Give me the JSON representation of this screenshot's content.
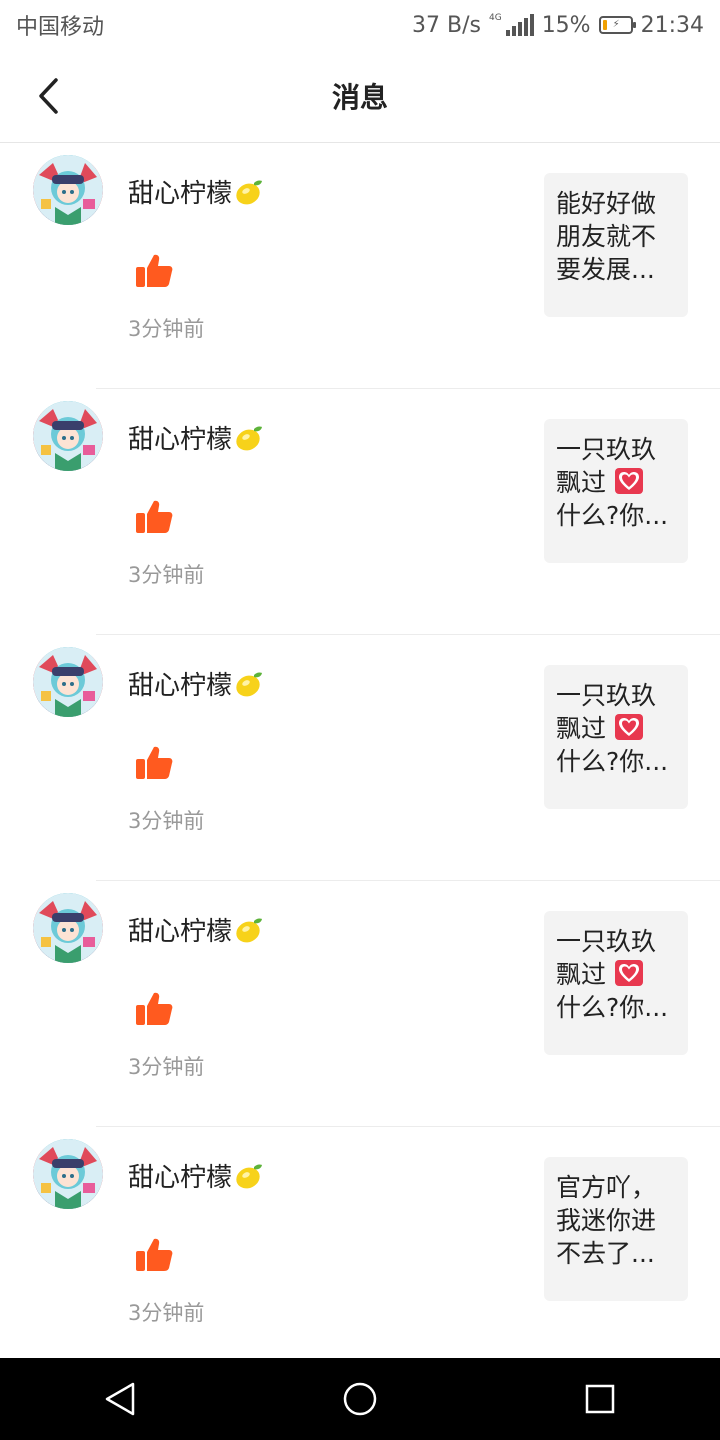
{
  "status_bar": {
    "carrier": "中国移动",
    "net_speed": "37 B/s",
    "network": "4G",
    "battery_percent": "15%",
    "battery_level": 0.15,
    "time": "21:34"
  },
  "header": {
    "title": "消息",
    "back_icon": "chevron-left-icon"
  },
  "notifications": [
    {
      "username": "甜心柠檬",
      "username_emoji": "lemon-icon",
      "action_icon": "thumbs-up-icon",
      "time": "3分钟前",
      "preview": [
        "能好好做",
        "朋友就不",
        "要发展..."
      ]
    },
    {
      "username": "甜心柠檬",
      "username_emoji": "lemon-icon",
      "action_icon": "thumbs-up-icon",
      "time": "3分钟前",
      "preview": [
        "一只玖玖",
        "飘过",
        "什么?你..."
      ]
    },
    {
      "username": "甜心柠檬",
      "username_emoji": "lemon-icon",
      "action_icon": "thumbs-up-icon",
      "time": "3分钟前",
      "preview": [
        "一只玖玖",
        "飘过",
        "什么?你..."
      ]
    },
    {
      "username": "甜心柠檬",
      "username_emoji": "lemon-icon",
      "action_icon": "thumbs-up-icon",
      "time": "3分钟前",
      "preview": [
        "一只玖玖",
        "飘过",
        "什么?你..."
      ]
    },
    {
      "username": "甜心柠檬",
      "username_emoji": "lemon-icon",
      "action_icon": "thumbs-up-icon",
      "time": "3分钟前",
      "preview": [
        "官方吖，",
        "我迷你进",
        "不去了..."
      ]
    }
  ],
  "colors": {
    "accent_like": "#ff5a1f",
    "time_text": "#999999",
    "preview_bg": "#f3f3f3"
  },
  "nav_bar": {
    "back": "triangle-back-icon",
    "home": "circle-home-icon",
    "recents": "square-recents-icon"
  }
}
